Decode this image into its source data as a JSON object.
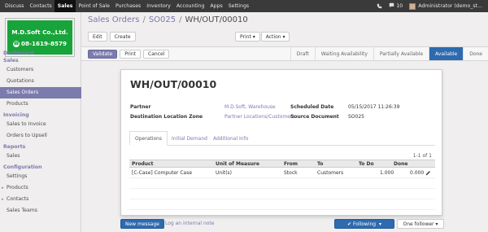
{
  "topbar": {
    "menu": [
      "Discuss",
      "Contacts",
      "Sales",
      "Point of Sale",
      "Purchases",
      "Inventory",
      "Accounting",
      "Apps",
      "Settings"
    ],
    "active": "Sales",
    "notifications_count": "10",
    "user_name": "Administrator (demo_st..."
  },
  "logo": {
    "company": "M.D.Soft Co.,Ltd.",
    "phone": "08-1619-8579",
    "brand_color": "#18a43a"
  },
  "sidebar": {
    "dashboard": "Dashboard",
    "sections": [
      {
        "title": "Sales",
        "items": [
          {
            "label": "Customers",
            "active": false
          },
          {
            "label": "Quotations",
            "active": false
          },
          {
            "label": "Sales Orders",
            "active": true
          },
          {
            "label": "Products",
            "active": false
          }
        ]
      },
      {
        "title": "Invoicing",
        "items": [
          {
            "label": "Sales to Invoice",
            "active": false
          },
          {
            "label": "Orders to Upsell",
            "active": false
          }
        ]
      },
      {
        "title": "Reports",
        "items": [
          {
            "label": "Sales",
            "active": false
          }
        ]
      },
      {
        "title": "Configuration",
        "items": [
          {
            "label": "Settings",
            "active": false
          },
          {
            "label": "Products",
            "active": false,
            "expandable": true
          },
          {
            "label": "Contacts",
            "active": false,
            "expandable": true
          },
          {
            "label": "Sales Teams",
            "active": false
          }
        ]
      }
    ]
  },
  "breadcrumb": {
    "root": "Sales Orders",
    "order": "SO025",
    "current": "WH/OUT/00010"
  },
  "toolbar": {
    "edit": "Edit",
    "create": "Create",
    "print": "Print",
    "action": "Action"
  },
  "status_actions": {
    "validate": "Validate",
    "print": "Print",
    "cancel": "Cancel"
  },
  "stages": [
    {
      "label": "Draft",
      "active": false
    },
    {
      "label": "Waiting Availability",
      "active": false
    },
    {
      "label": "Partially Available",
      "active": false
    },
    {
      "label": "Available",
      "active": true
    },
    {
      "label": "Done",
      "active": false
    }
  ],
  "record": {
    "name": "WH/OUT/00010",
    "partner_label": "Partner",
    "partner": "M.D.Soft, Warehouse",
    "dest_label": "Destination Location Zone",
    "dest": "Partner Locations/Customers",
    "scheduled_label": "Scheduled Date",
    "scheduled": "05/15/2017 11:26:39",
    "source_label": "Source Document",
    "source": "SO025"
  },
  "tabs": [
    "Operations",
    "Initial Demand",
    "Additional Info"
  ],
  "pager": "1-1 of 1",
  "table": {
    "headers": [
      "Product",
      "Unit of Measure",
      "From",
      "To",
      "To Do",
      "Done"
    ],
    "rows": [
      [
        "[C-Case] Computer Case",
        "Unit(s)",
        "Stock",
        "Customers",
        "1.000",
        "0.000"
      ]
    ]
  },
  "chatter": {
    "new_message": "New message",
    "log_note": "Log an internal note",
    "following": "Following",
    "followers": "One follower"
  },
  "colors": {
    "topbar": "#3a3a3a",
    "accent": "#7c7bad",
    "primary_blue": "#2e6aae"
  }
}
